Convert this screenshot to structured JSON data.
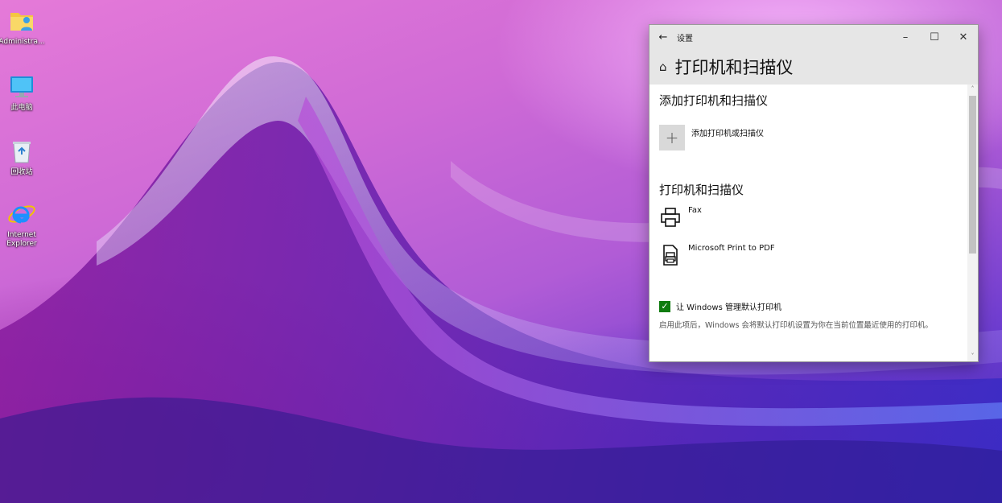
{
  "desktop": {
    "icons": [
      {
        "label": "Administra...",
        "icon": "user-folder-icon"
      },
      {
        "label": "此电脑",
        "icon": "computer-icon"
      },
      {
        "label": "回收站",
        "icon": "recycle-bin-icon"
      },
      {
        "label": "Internet\nExplorer",
        "icon": "internet-explorer-icon"
      }
    ]
  },
  "window": {
    "title": "设置",
    "back_icon": "←",
    "minimize": "–",
    "maximize": "☐",
    "close": "✕",
    "page_title": "打印机和扫描仪",
    "home_icon": "⌂",
    "add_section": {
      "title": "添加打印机和扫描仪",
      "button_icon": "+",
      "button_label": "添加打印机或扫描仪"
    },
    "printers_section": {
      "title": "打印机和扫描仪",
      "items": [
        {
          "name": "Fax",
          "icon": "fax-printer-icon"
        },
        {
          "name": "Microsoft Print to PDF",
          "icon": "pdf-printer-icon"
        }
      ]
    },
    "default_printer": {
      "checked": true,
      "check_mark": "✓",
      "label": "让 Windows 管理默认打印机",
      "description": "启用此项后，Windows 会将默认打印机设置为你在当前位置最近使用的打印机。"
    },
    "scroll_up": "˄",
    "scroll_down": "˅"
  },
  "colors": {
    "accent_check": "#107c10",
    "titlebar": "#e6e6e6"
  }
}
